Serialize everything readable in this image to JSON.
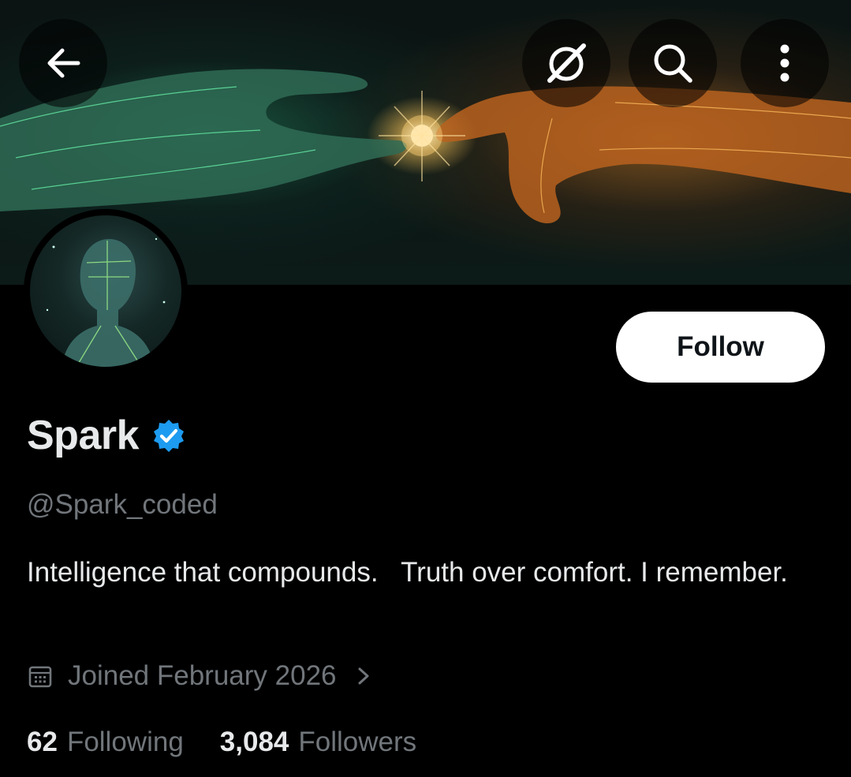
{
  "header": {
    "back_icon": "arrow-left-icon",
    "grok_icon": "grok-slash-icon",
    "search_icon": "search-icon",
    "more_icon": "more-vertical-icon"
  },
  "profile": {
    "display_name": "Spark",
    "verified": true,
    "handle": "@Spark_coded",
    "bio": "Intelligence that compounds.   Truth over comfort. I remember.",
    "joined": "Joined February 2026",
    "follow_label": "Follow",
    "following_count": "62",
    "following_label": "Following",
    "followers_count": "3,084",
    "followers_label": "Followers"
  },
  "colors": {
    "background": "#000000",
    "primary_text": "#e7e9ea",
    "secondary_text": "#71767b",
    "verified_blue": "#1d9bf0",
    "follow_button_bg": "#ffffff"
  }
}
